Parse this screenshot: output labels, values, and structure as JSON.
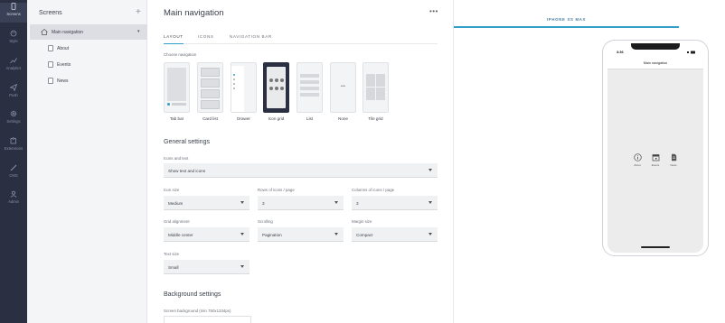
{
  "rail": {
    "items": [
      {
        "label": "Screens",
        "icon": "phone-icon"
      },
      {
        "label": "Style",
        "icon": "palette-icon"
      },
      {
        "label": "Analytics",
        "icon": "chart-icon"
      },
      {
        "label": "Push",
        "icon": "paper-plane-icon"
      },
      {
        "label": "Settings",
        "icon": "gear-icon"
      },
      {
        "label": "Extensions",
        "icon": "puzzle-icon"
      },
      {
        "label": "CMS",
        "icon": "pencil-icon"
      },
      {
        "label": "Admin",
        "icon": "admin-icon"
      }
    ]
  },
  "screens": {
    "title": "Screens",
    "add": "+",
    "items": [
      {
        "label": "Main navigation"
      },
      {
        "label": "About"
      },
      {
        "label": "Events"
      },
      {
        "label": "News"
      }
    ]
  },
  "main": {
    "title": "Main navigation",
    "more": "•••",
    "tabs": [
      "LAYOUT",
      "ICONS",
      "NAVIGATION BAR"
    ],
    "choose_label": "Choose navigation",
    "nav_options": [
      "Tab bar",
      "Card list",
      "Drawer",
      "Icon grid",
      "List",
      "None",
      "Tile grid"
    ],
    "selected_nav": "Icon grid",
    "general_title": "General settings",
    "icons_text_label": "Icons and text",
    "icons_text_value": "Show text and icons",
    "icon_size_label": "Icon size",
    "icon_size_value": "Medium",
    "rows_label": "Rows of icons / page",
    "rows_value": "3",
    "cols_label": "Columns of icons / page",
    "cols_value": "3",
    "align_label": "Grid alignment",
    "align_value": "Middle center",
    "scroll_label": "Scrolling",
    "scroll_value": "Pagination",
    "margin_label": "Margin size",
    "margin_value": "Compact",
    "text_size_label": "Text size",
    "text_size_value": "Small",
    "bg_title": "Background settings",
    "bg_label": "Screen background (min 750x1334px)"
  },
  "preview": {
    "device": "IPHONE XS MAX",
    "time": "3:36",
    "nav_title": "Main navigation",
    "grid": [
      {
        "label": "About",
        "icon": "info-icon"
      },
      {
        "label": "Events",
        "icon": "calendar-icon"
      },
      {
        "label": "News",
        "icon": "document-icon"
      }
    ]
  },
  "colors": {
    "accent": "#2f9fc9",
    "rail": "#2a3042",
    "selected_tile": "#2a3042"
  }
}
